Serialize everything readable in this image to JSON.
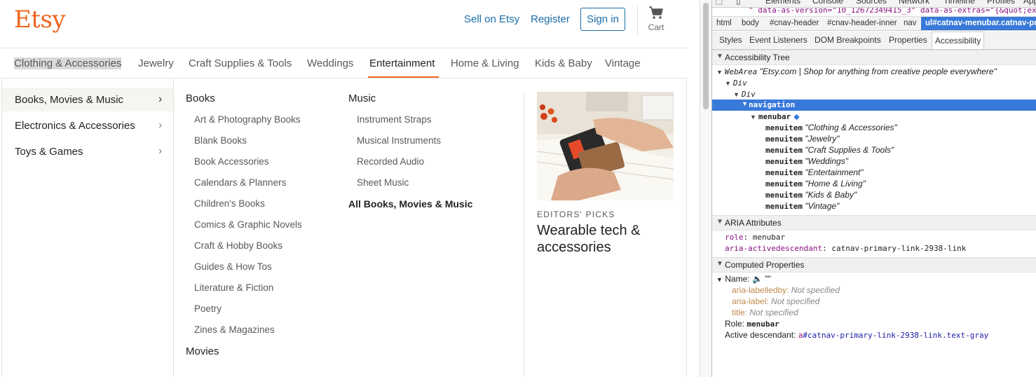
{
  "etsy": {
    "logo": "Etsy",
    "header": {
      "sell": "Sell on Etsy",
      "register": "Register",
      "signin": "Sign in",
      "cart": "Cart"
    },
    "categories": [
      "Clothing & Accessories",
      "Jewelry",
      "Craft Supplies & Tools",
      "Weddings",
      "Entertainment",
      "Home & Living",
      "Kids & Baby",
      "Vintage"
    ],
    "subcategories": [
      "Books, Movies & Music",
      "Electronics & Accessories",
      "Toys & Games"
    ],
    "books": {
      "heading": "Books",
      "links": [
        "Art & Photography Books",
        "Blank Books",
        "Book Accessories",
        "Calendars & Planners",
        "Children's Books",
        "Comics & Graphic Novels",
        "Craft & Hobby Books",
        "Guides & How Tos",
        "Literature & Fiction",
        "Poetry",
        "Zines & Magazines"
      ]
    },
    "movies_heading": "Movies",
    "music": {
      "heading": "Music",
      "links": [
        "Instrument Straps",
        "Musical Instruments",
        "Recorded Audio",
        "Sheet Music"
      ],
      "all": "All Books, Movies & Music"
    },
    "editors": {
      "label": "EDITORS' PICKS",
      "title": "Wearable tech & accessories"
    },
    "colors": {
      "brand": "#F1641E",
      "link": "#1a6da9",
      "selection": "#3879d9"
    }
  },
  "devtools": {
    "tabs": [
      "Elements",
      "Console",
      "Sources",
      "Network",
      "Timeline",
      "Profiles",
      "App"
    ],
    "code_line": "\" data-as-version=\"10_12672349415_3\" data-as-extras=\"{&quot;ex",
    "breadcrumbs": [
      "html",
      "body",
      "#cnav-header",
      "#cnav-header-inner",
      "nav",
      "ul#catnav-menubar.catnav-prim"
    ],
    "subtabs": [
      "Styles",
      "Event Listeners",
      "DOM Breakpoints",
      "Properties",
      "Accessibility"
    ],
    "tree_header": "Accessibility Tree",
    "tree": {
      "webarea_role": "WebArea",
      "webarea_name": "\"Etsy.com | Shop for anything from creative people everywhere\"",
      "div1": "Div",
      "div2": "Div",
      "navigation": "navigation",
      "menubar": "menubar",
      "menuitem_role": "menuitem",
      "menuitems": [
        "\"Clothing & Accessories\"",
        "\"Jewelry\"",
        "\"Craft Supplies & Tools\"",
        "\"Weddings\"",
        "\"Entertainment\"",
        "\"Home & Living\"",
        "\"Kids & Baby\"",
        "\"Vintage\""
      ]
    },
    "aria_header": "ARIA Attributes",
    "aria": {
      "role_key": "role",
      "role_val": "menubar",
      "active_key": "aria-activedescendant",
      "active_val": "catnav-primary-link-2938-link"
    },
    "computed_header": "Computed Properties",
    "computed": {
      "name_label": "Name:",
      "name_val": "\"\"",
      "labelledby_key": "aria-labelledby:",
      "labelledby_val": "Not specified",
      "label_key": "aria-label:",
      "label_val": "Not specified",
      "title_key": "title:",
      "title_val": "Not specified",
      "role_label": "Role:",
      "role_val": "menubar",
      "active_label": "Active descendant:",
      "active_tag": "a",
      "active_id": "#catnav-primary-link-2938-link",
      "active_cls": ".text-gray"
    }
  }
}
